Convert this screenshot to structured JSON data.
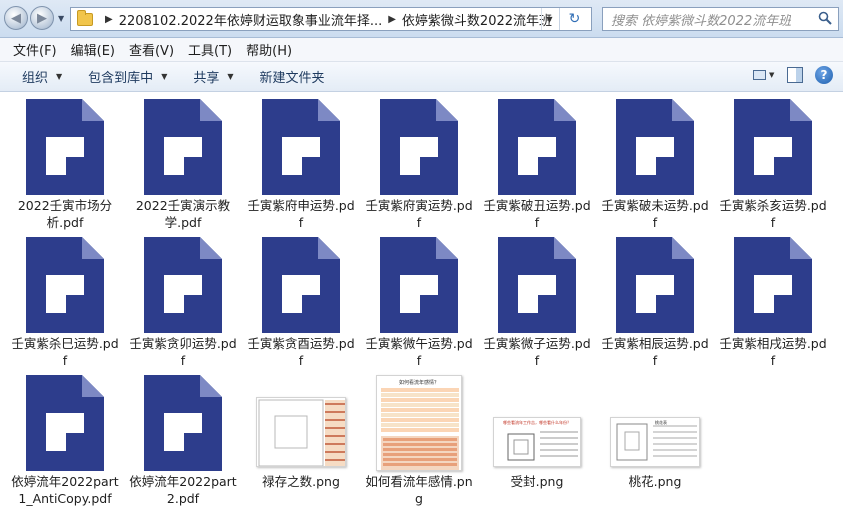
{
  "address_bar": {
    "crumbs": [
      "2208102.2022年依婷财运取象事业流年择...",
      "依婷紫微斗数2022流年班"
    ],
    "search_placeholder": "搜索 依婷紫微斗数2022流年班"
  },
  "menu": [
    "文件(F)",
    "编辑(E)",
    "查看(V)",
    "工具(T)",
    "帮助(H)"
  ],
  "toolbar": {
    "organize": "组织",
    "include_in_library": "包含到库中",
    "share": "共享",
    "new_folder": "新建文件夹"
  },
  "files": [
    {
      "name": "2022壬寅市场分析.pdf",
      "type": "pdf"
    },
    {
      "name": "2022壬寅演示教学.pdf",
      "type": "pdf"
    },
    {
      "name": "壬寅紫府申运势.pdf",
      "type": "pdf"
    },
    {
      "name": "壬寅紫府寅运势.pdf",
      "type": "pdf"
    },
    {
      "name": "壬寅紫破丑运势.pdf",
      "type": "pdf"
    },
    {
      "name": "壬寅紫破未运势.pdf",
      "type": "pdf"
    },
    {
      "name": "壬寅紫杀亥运势.pdf",
      "type": "pdf"
    },
    {
      "name": "壬寅紫杀巳运势.pdf",
      "type": "pdf"
    },
    {
      "name": "壬寅紫贪卯运势.pdf",
      "type": "pdf"
    },
    {
      "name": "壬寅紫贪酉运势.pdf",
      "type": "pdf"
    },
    {
      "name": "壬寅紫微午运势.pdf",
      "type": "pdf"
    },
    {
      "name": "壬寅紫微子运势.pdf",
      "type": "pdf"
    },
    {
      "name": "壬寅紫相辰运势.pdf",
      "type": "pdf"
    },
    {
      "name": "壬寅紫相戌运势.pdf",
      "type": "pdf"
    },
    {
      "name": "依婷流年2022part 1_AntiCopy.pdf",
      "type": "pdf"
    },
    {
      "name": "依婷流年2022part 2.pdf",
      "type": "pdf"
    },
    {
      "name": "禄存之数.png",
      "type": "png"
    },
    {
      "name": "如何看流年感情.png",
      "type": "png"
    },
    {
      "name": "受封.png",
      "type": "png"
    },
    {
      "name": "桃花.png",
      "type": "png"
    }
  ],
  "thumbnail_text": {
    "png2_title": "如何看流年感情？",
    "png3_title": "哪些看流年工作吉，哪些看什么年份？",
    "png4_title": "桃花表"
  },
  "colors": {
    "pdf_icon_blue": "#2d3d8c",
    "pdf_fold": "#7d89c4",
    "toolbar_text": "#1e3a5f"
  }
}
